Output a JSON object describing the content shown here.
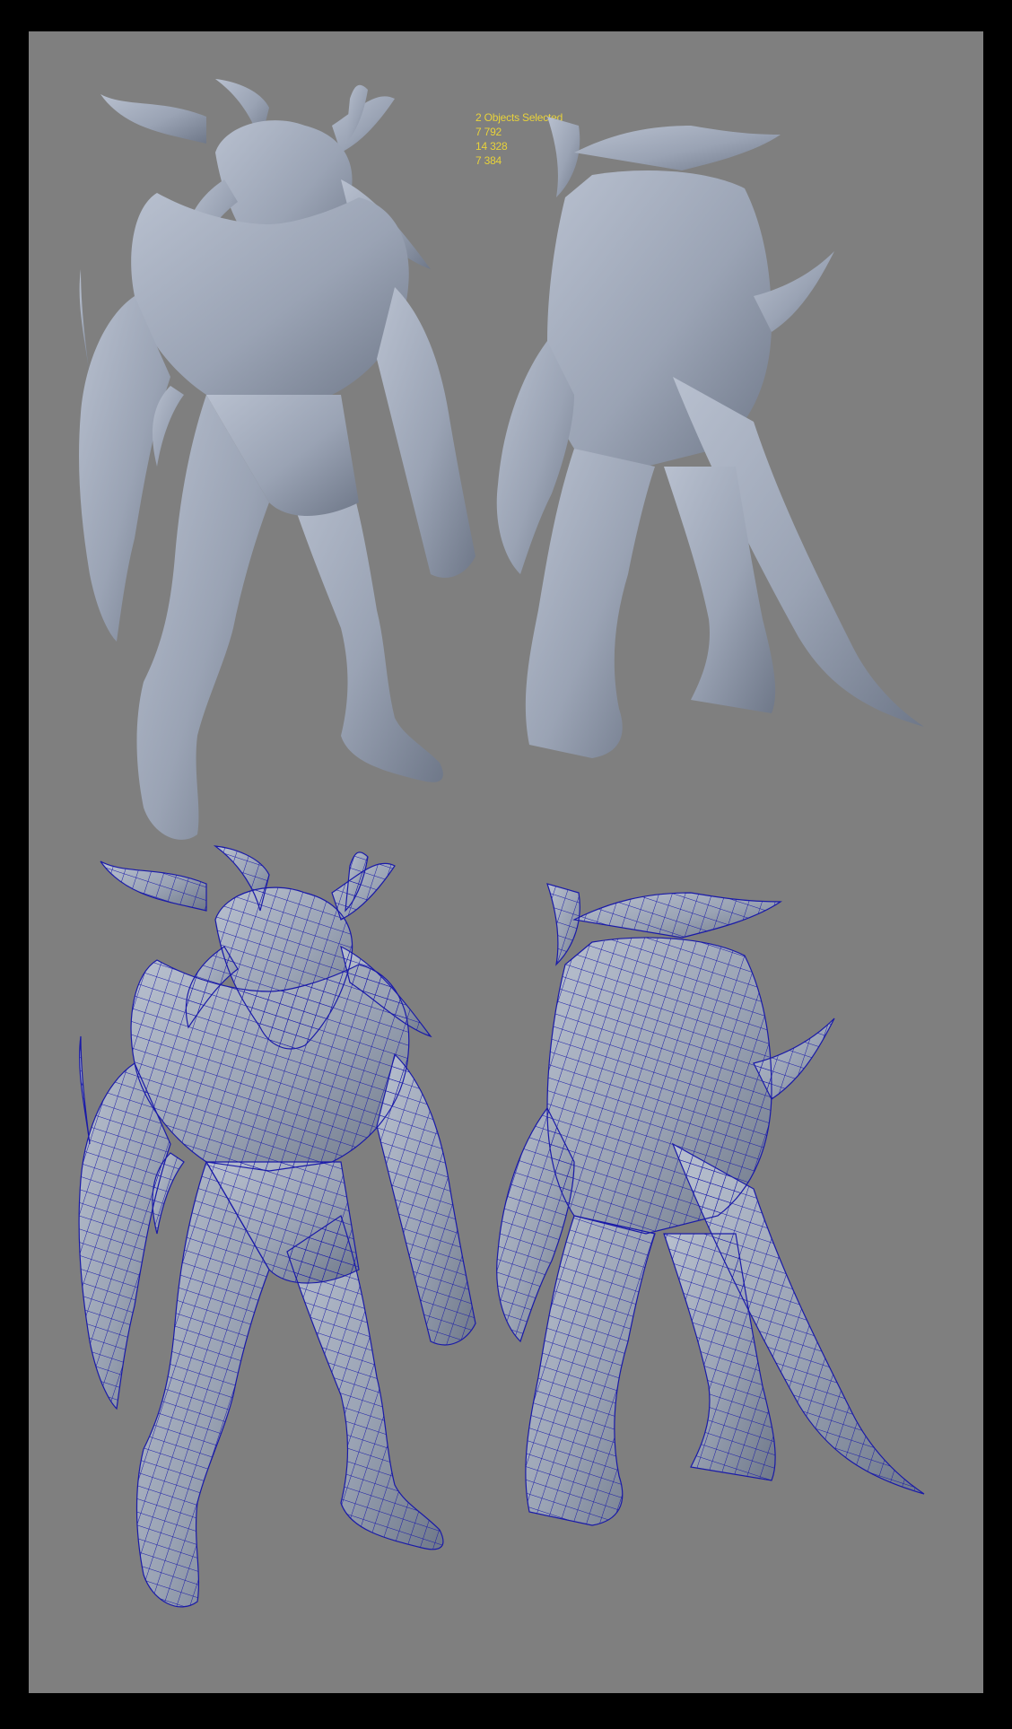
{
  "viewport": {
    "background": "#7f7f7f",
    "frame_color": "#000000",
    "wire_color": "#1a1aa8",
    "shade_color": "#a7afbf"
  },
  "hud": {
    "lines": [
      "2 Objects Selected",
      "7 792",
      "14 328",
      "7 384"
    ],
    "color": "#e8d23a"
  }
}
